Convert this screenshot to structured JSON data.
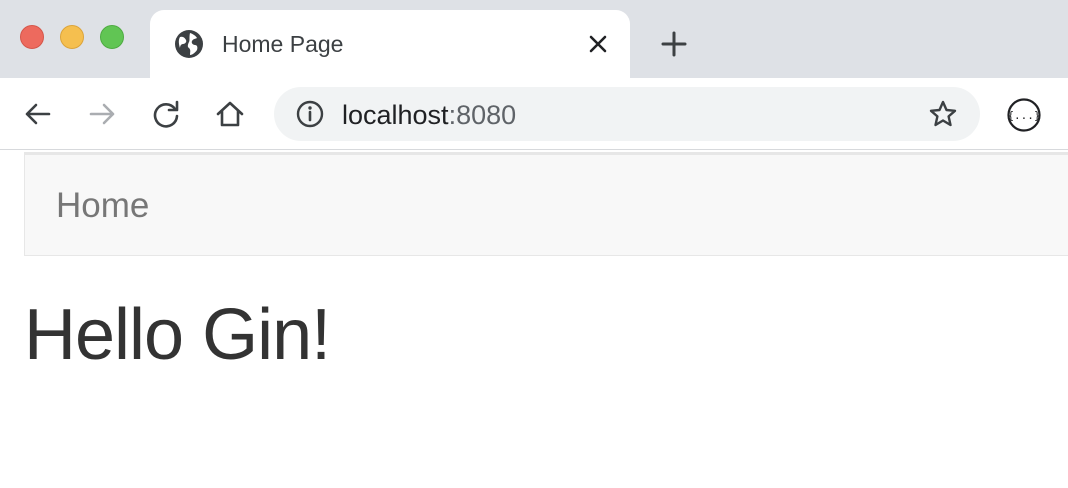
{
  "browser": {
    "tab": {
      "title": "Home Page",
      "favicon": "globe-icon"
    },
    "omnibox": {
      "host": "localhost",
      "port": ":8080"
    },
    "icons": {
      "back": "arrow-left-icon",
      "forward": "arrow-right-icon",
      "reload": "reload-icon",
      "home": "home-icon",
      "info": "info-icon",
      "bookmark": "star-icon",
      "extension": "json-formatter-icon",
      "close_tab": "close-icon",
      "new_tab": "plus-icon"
    },
    "colors": {
      "tabstrip": "#dee1e6",
      "omnibox": "#f1f3f4",
      "close": "#ed6a5e",
      "minimize": "#f5bf4f",
      "maximize": "#61c554"
    }
  },
  "page": {
    "navbar": {
      "brand": "Home"
    },
    "heading": "Hello Gin!"
  }
}
